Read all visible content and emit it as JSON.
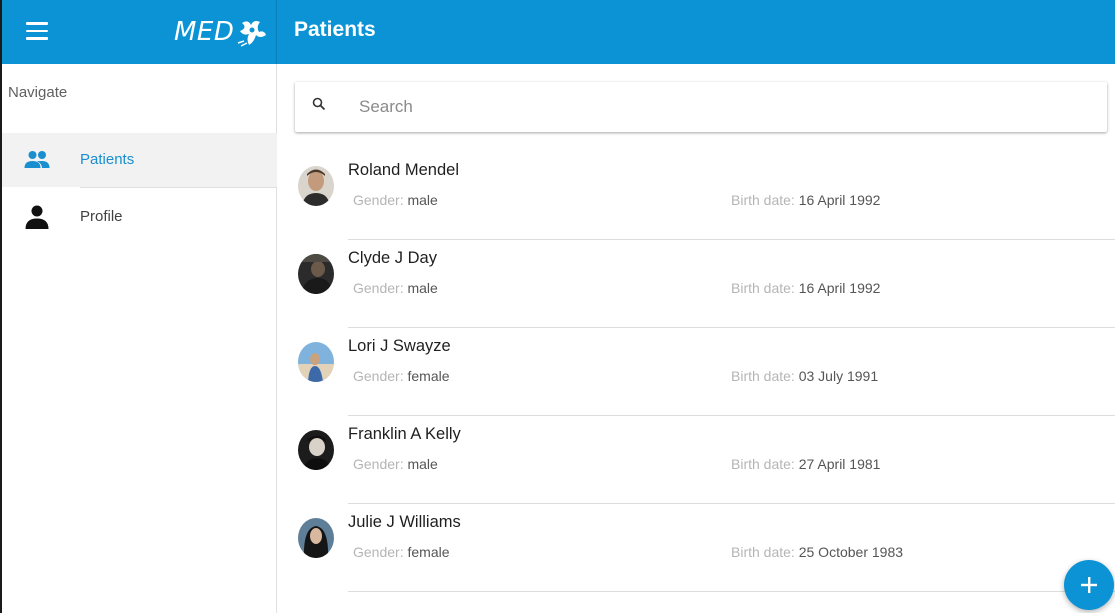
{
  "app": {
    "logo_text": "MED",
    "page_title": "Patients",
    "accent_color": "#0b93d6"
  },
  "sidebar": {
    "heading": "Navigate",
    "items": [
      {
        "label": "Patients",
        "icon": "people-icon",
        "active": true
      },
      {
        "label": "Profile",
        "icon": "person-icon",
        "active": false
      }
    ]
  },
  "search": {
    "placeholder": "Search",
    "value": ""
  },
  "patients": {
    "gender_key": "Gender:",
    "birth_key": "Birth date:",
    "rows": [
      {
        "name": "Roland Mendel",
        "gender": "male",
        "birth_date": "16 April 1992"
      },
      {
        "name": "Clyde J Day",
        "gender": "male",
        "birth_date": "16 April 1992"
      },
      {
        "name": "Lori J Swayze",
        "gender": "female",
        "birth_date": "03 July 1991"
      },
      {
        "name": "Franklin A Kelly",
        "gender": "male",
        "birth_date": "27 April 1981"
      },
      {
        "name": "Julie J Williams",
        "gender": "female",
        "birth_date": "25 October 1983"
      }
    ]
  },
  "fab": {
    "icon": "plus-icon"
  }
}
